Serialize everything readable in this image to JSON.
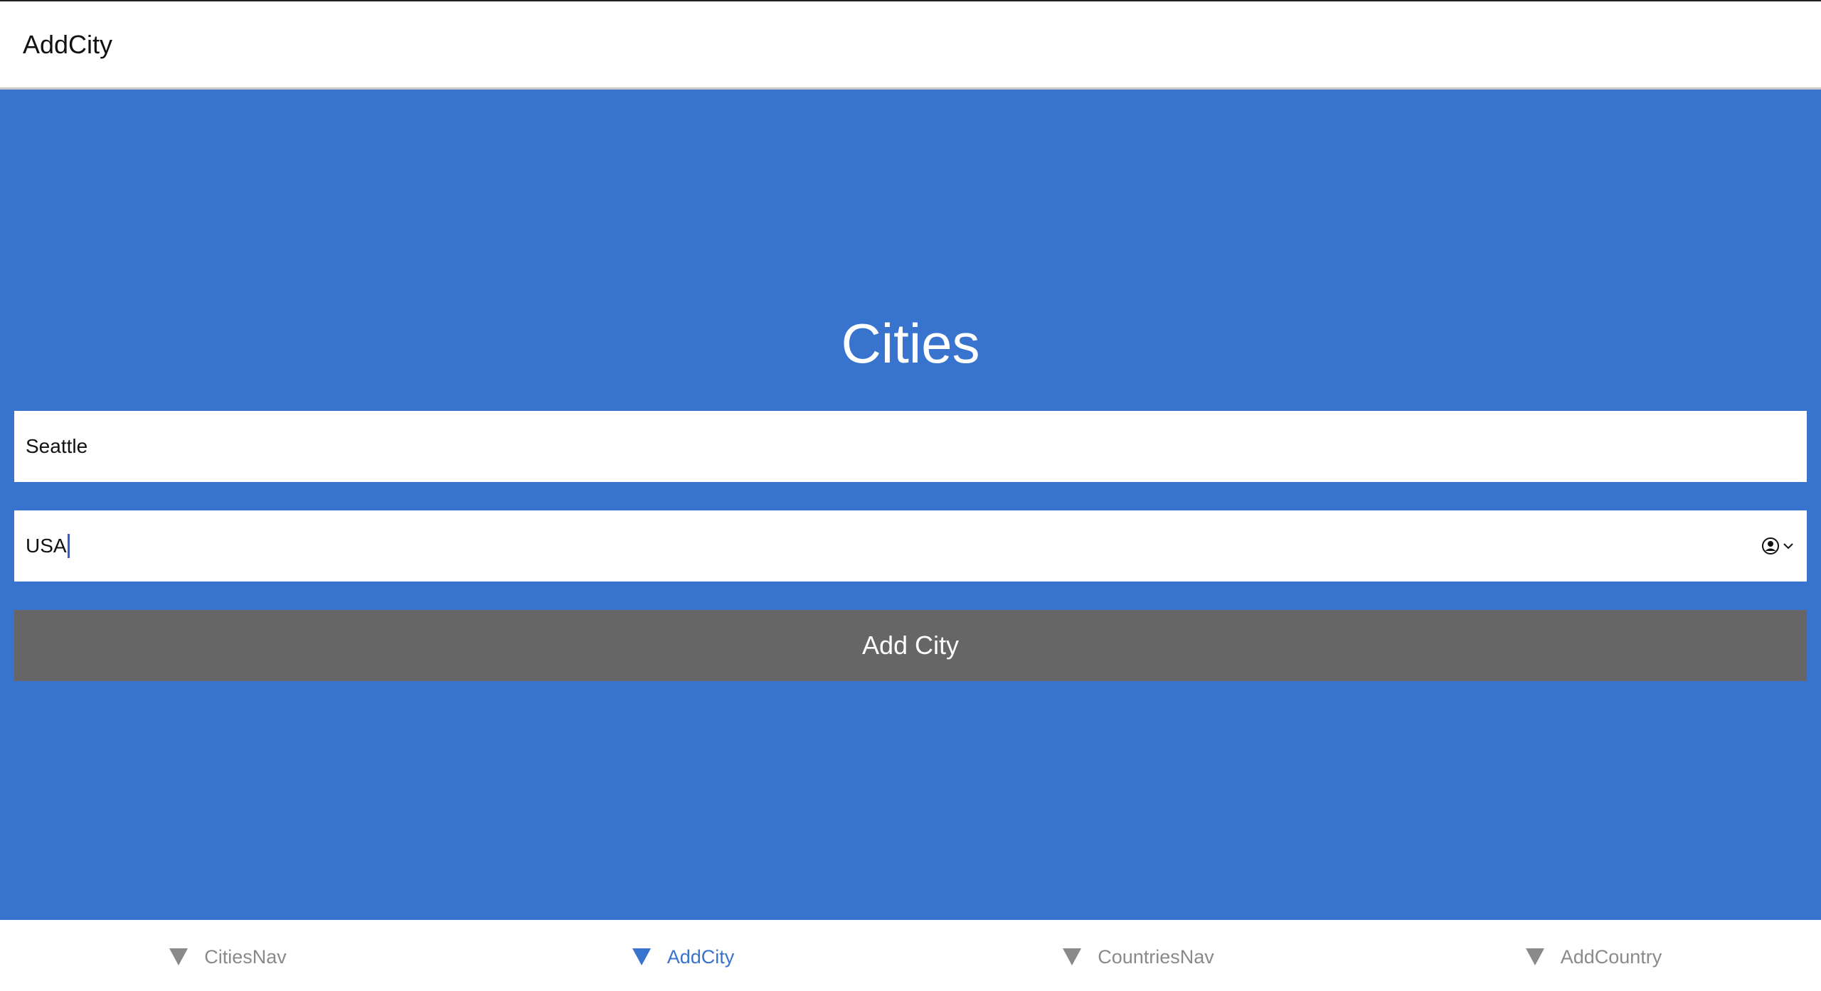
{
  "header": {
    "title": "AddCity"
  },
  "main": {
    "title": "Cities",
    "city_field": {
      "value": "Seattle"
    },
    "country_field": {
      "value": "USA",
      "autofill_icon": "contact-autofill-icon"
    },
    "add_button_label": "Add City",
    "background_color": "#3874cd"
  },
  "tabbar": {
    "tabs": [
      {
        "label": "CitiesNav",
        "icon": "triangle-down-icon",
        "active": false
      },
      {
        "label": "AddCity",
        "icon": "triangle-down-icon",
        "active": true
      },
      {
        "label": "CountriesNav",
        "icon": "triangle-down-icon",
        "active": false
      },
      {
        "label": "AddCountry",
        "icon": "triangle-down-icon",
        "active": false
      }
    ],
    "active_color": "#3874cd",
    "inactive_color": "#8a8a8a"
  },
  "button_color": "#666666"
}
